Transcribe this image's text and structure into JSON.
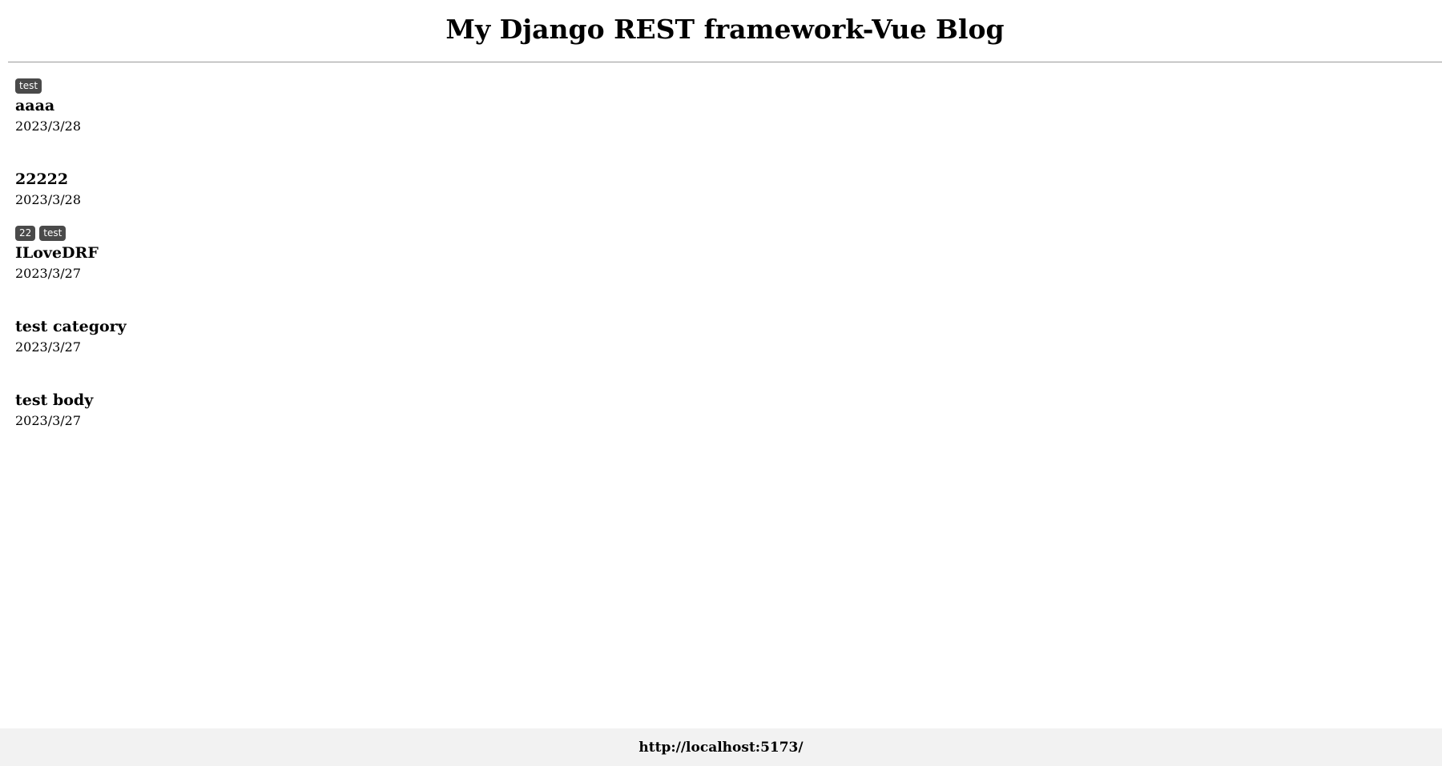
{
  "header": {
    "title": "My Django REST framework-Vue Blog"
  },
  "articles": [
    {
      "tags": [
        "test"
      ],
      "title": "aaaa",
      "date": "2023/3/28"
    },
    {
      "tags": [],
      "title": "22222",
      "date": "2023/3/28"
    },
    {
      "tags": [
        "22",
        "test"
      ],
      "title": "ILoveDRF",
      "date": "2023/3/27"
    },
    {
      "tags": [],
      "title": "test category",
      "date": "2023/3/27"
    },
    {
      "tags": [],
      "title": "test body",
      "date": "2023/3/27"
    }
  ],
  "footer": {
    "url": "http://localhost:5173/"
  },
  "colors": {
    "tag_background": "#4a4a4a",
    "footer_background": "#f2f2f2",
    "divider": "#9a9a9a"
  }
}
